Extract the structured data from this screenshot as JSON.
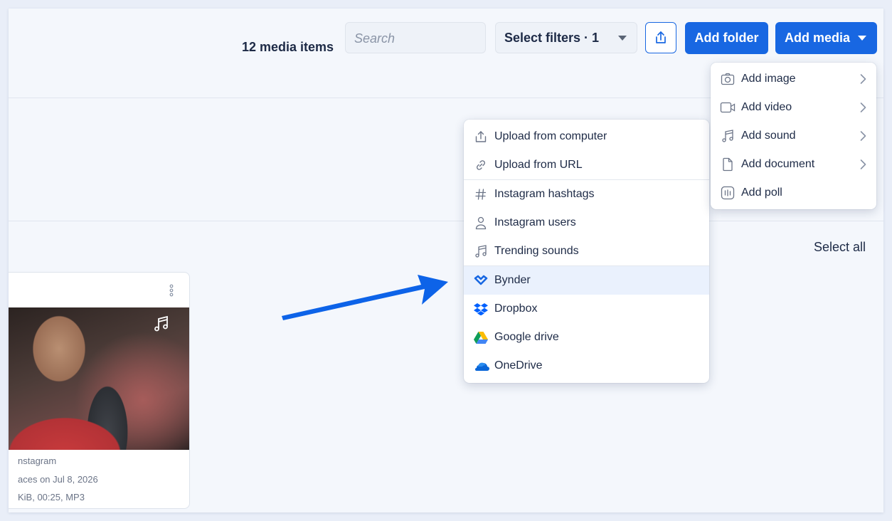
{
  "toolbar": {
    "count_label": "12 media items",
    "search_placeholder": "Search",
    "filters_label": "Select filters · 1",
    "add_folder_label": "Add folder",
    "add_media_label": "Add media"
  },
  "select_all_label": "Select all",
  "card": {
    "meta": [
      "nstagram",
      "aces on Jul 8, 2026",
      "KiB, 00:25, MP3"
    ]
  },
  "add_media_menu": {
    "items": [
      {
        "label": "Add image",
        "icon": "camera-icon"
      },
      {
        "label": "Add video",
        "icon": "video-icon"
      },
      {
        "label": "Add sound",
        "icon": "music-note-icon"
      },
      {
        "label": "Add document",
        "icon": "document-icon"
      },
      {
        "label": "Add poll",
        "icon": "poll-icon"
      }
    ]
  },
  "source_menu": {
    "items": [
      {
        "label": "Upload from computer",
        "icon": "upload-icon"
      },
      {
        "label": "Upload from URL",
        "icon": "link-icon"
      },
      {
        "label": "Instagram hashtags",
        "icon": "hashtag-icon"
      },
      {
        "label": "Instagram users",
        "icon": "user-icon"
      },
      {
        "label": "Trending sounds",
        "icon": "music-note-icon"
      },
      {
        "label": "Bynder",
        "icon": "bynder-icon"
      },
      {
        "label": "Dropbox",
        "icon": "dropbox-icon"
      },
      {
        "label": "Google drive",
        "icon": "google-drive-icon"
      },
      {
        "label": "OneDrive",
        "icon": "onedrive-icon"
      }
    ],
    "highlighted": "Bynder"
  },
  "colors": {
    "primary": "#1867e2",
    "annotation_arrow": "#0d63e8",
    "highlight_bg": "#eaf1fd"
  }
}
